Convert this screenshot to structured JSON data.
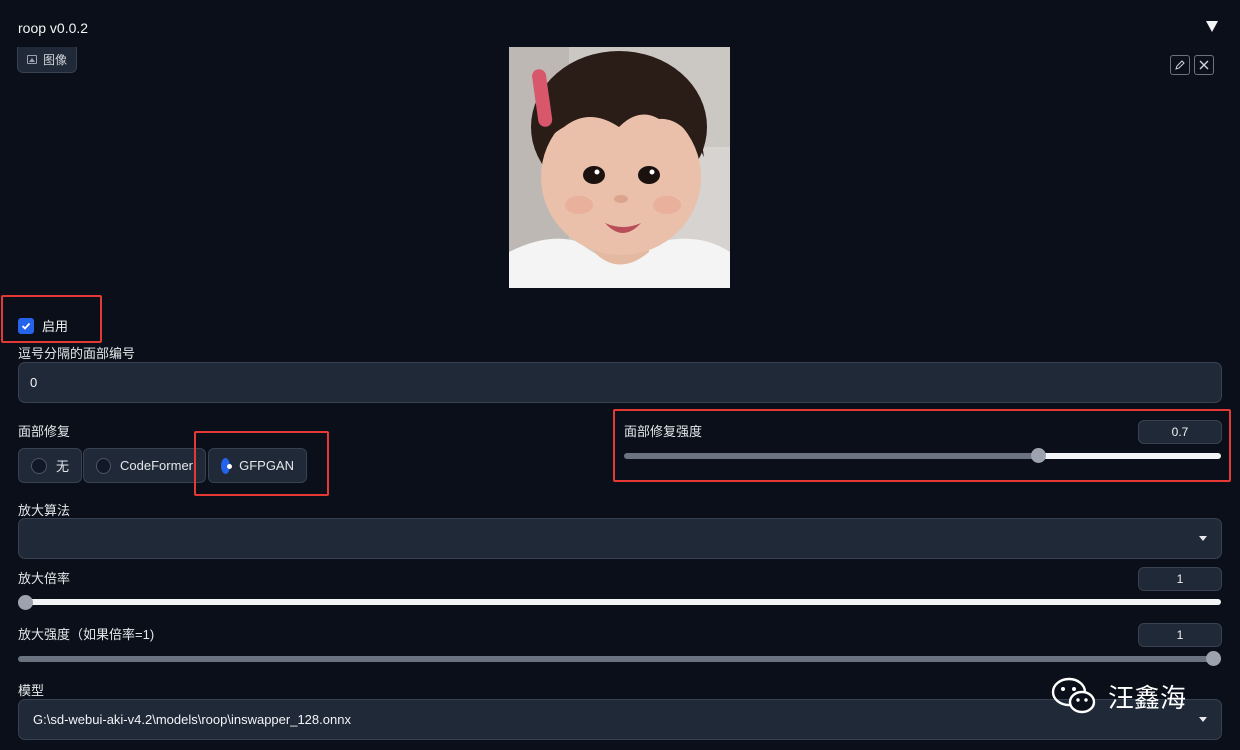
{
  "header": {
    "title": "roop v0.0.2"
  },
  "image_panel": {
    "tab_label": "图像"
  },
  "enable": {
    "label": "启用",
    "checked": true
  },
  "face_index": {
    "label": "逗号分隔的面部编号",
    "value": "0"
  },
  "face_restore": {
    "label": "面部修复",
    "options": [
      "无",
      "CodeFormer",
      "GFPGAN"
    ],
    "selected": "GFPGAN"
  },
  "restore_strength": {
    "label": "面部修复强度",
    "value": "0.7",
    "fraction": 0.7
  },
  "upscaler": {
    "label": "放大算法",
    "value": ""
  },
  "upscale_ratio": {
    "label": "放大倍率",
    "value": "1",
    "fraction": 0.0
  },
  "upscale_strength": {
    "label": "放大强度（如果倍率=1)",
    "value": "1",
    "fraction": 1.0
  },
  "model": {
    "label": "模型",
    "value": "G:\\sd-webui-aki-v4.2\\models\\roop\\inswapper_128.onnx"
  },
  "watermark": {
    "text": "汪鑫海"
  },
  "colors": {
    "accent": "#2563eb",
    "annotation": "#e53935",
    "background": "#0b0f19"
  }
}
